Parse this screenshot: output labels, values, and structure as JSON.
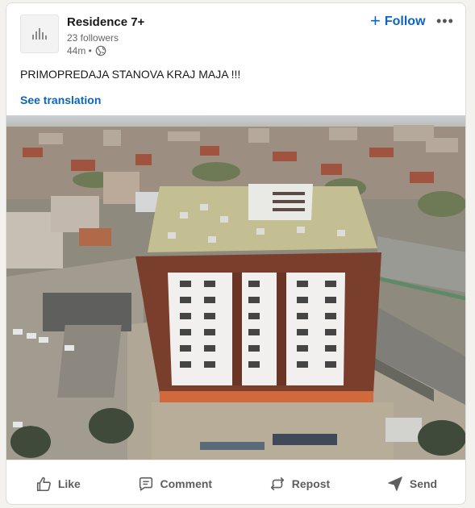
{
  "post": {
    "author_name": "Residence 7+",
    "followers": "23 followers",
    "time": "44m •",
    "follow_label": "Follow",
    "body_text": "PRIMOPREDAJA STANOVA KRAJ MAJA !!!",
    "see_translation": "See translation"
  },
  "actions": {
    "like": "Like",
    "comment": "Comment",
    "repost": "Repost",
    "send": "Send"
  },
  "colors": {
    "link_blue": "#0a66c2",
    "text_primary": "#191919",
    "text_secondary": "#666666"
  },
  "icons": [
    "globe-icon",
    "plus-icon",
    "more-icon",
    "like-icon",
    "comment-icon",
    "repost-icon",
    "send-icon"
  ]
}
